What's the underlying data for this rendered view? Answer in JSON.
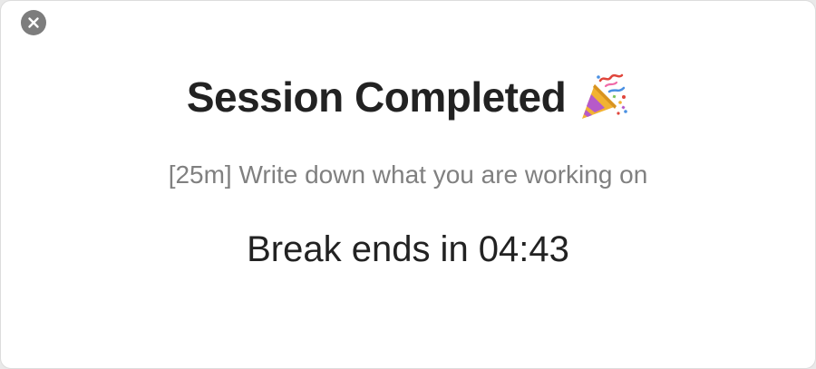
{
  "dialog": {
    "title": "Session Completed",
    "title_icon": "party-popper-icon",
    "subtitle": "[25m] Write down what you are working on",
    "countdown_label": "Break ends in 04:43",
    "close_icon": "close-icon"
  },
  "colors": {
    "close_button": "#7d7d7d",
    "title_text": "#222222",
    "subtitle_text": "#808080",
    "background": "#ffffff"
  }
}
